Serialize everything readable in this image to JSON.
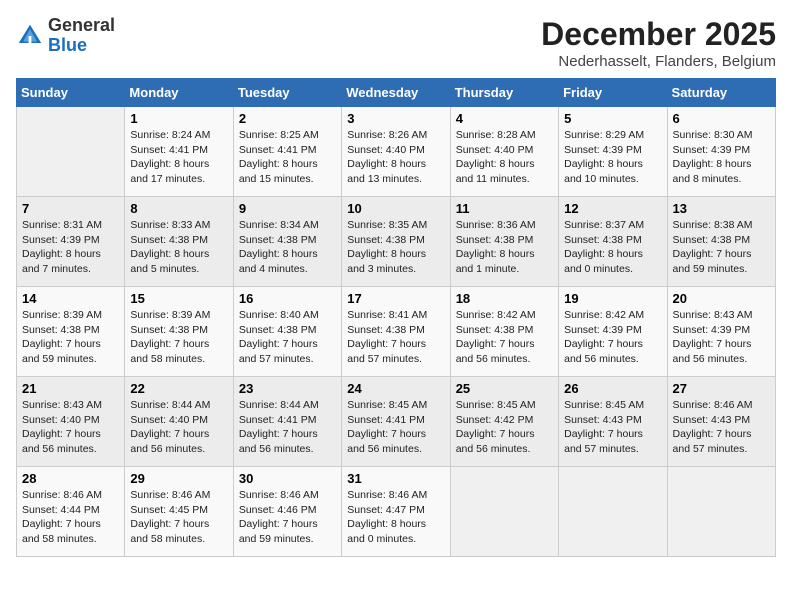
{
  "logo": {
    "general": "General",
    "blue": "Blue"
  },
  "title": "December 2025",
  "subtitle": "Nederhasselt, Flanders, Belgium",
  "days_of_week": [
    "Sunday",
    "Monday",
    "Tuesday",
    "Wednesday",
    "Thursday",
    "Friday",
    "Saturday"
  ],
  "weeks": [
    [
      {
        "day": "",
        "content": ""
      },
      {
        "day": "1",
        "content": "Sunrise: 8:24 AM\nSunset: 4:41 PM\nDaylight: 8 hours\nand 17 minutes."
      },
      {
        "day": "2",
        "content": "Sunrise: 8:25 AM\nSunset: 4:41 PM\nDaylight: 8 hours\nand 15 minutes."
      },
      {
        "day": "3",
        "content": "Sunrise: 8:26 AM\nSunset: 4:40 PM\nDaylight: 8 hours\nand 13 minutes."
      },
      {
        "day": "4",
        "content": "Sunrise: 8:28 AM\nSunset: 4:40 PM\nDaylight: 8 hours\nand 11 minutes."
      },
      {
        "day": "5",
        "content": "Sunrise: 8:29 AM\nSunset: 4:39 PM\nDaylight: 8 hours\nand 10 minutes."
      },
      {
        "day": "6",
        "content": "Sunrise: 8:30 AM\nSunset: 4:39 PM\nDaylight: 8 hours\nand 8 minutes."
      }
    ],
    [
      {
        "day": "7",
        "content": "Sunrise: 8:31 AM\nSunset: 4:39 PM\nDaylight: 8 hours\nand 7 minutes."
      },
      {
        "day": "8",
        "content": "Sunrise: 8:33 AM\nSunset: 4:38 PM\nDaylight: 8 hours\nand 5 minutes."
      },
      {
        "day": "9",
        "content": "Sunrise: 8:34 AM\nSunset: 4:38 PM\nDaylight: 8 hours\nand 4 minutes."
      },
      {
        "day": "10",
        "content": "Sunrise: 8:35 AM\nSunset: 4:38 PM\nDaylight: 8 hours\nand 3 minutes."
      },
      {
        "day": "11",
        "content": "Sunrise: 8:36 AM\nSunset: 4:38 PM\nDaylight: 8 hours\nand 1 minute."
      },
      {
        "day": "12",
        "content": "Sunrise: 8:37 AM\nSunset: 4:38 PM\nDaylight: 8 hours\nand 0 minutes."
      },
      {
        "day": "13",
        "content": "Sunrise: 8:38 AM\nSunset: 4:38 PM\nDaylight: 7 hours\nand 59 minutes."
      }
    ],
    [
      {
        "day": "14",
        "content": "Sunrise: 8:39 AM\nSunset: 4:38 PM\nDaylight: 7 hours\nand 59 minutes."
      },
      {
        "day": "15",
        "content": "Sunrise: 8:39 AM\nSunset: 4:38 PM\nDaylight: 7 hours\nand 58 minutes."
      },
      {
        "day": "16",
        "content": "Sunrise: 8:40 AM\nSunset: 4:38 PM\nDaylight: 7 hours\nand 57 minutes."
      },
      {
        "day": "17",
        "content": "Sunrise: 8:41 AM\nSunset: 4:38 PM\nDaylight: 7 hours\nand 57 minutes."
      },
      {
        "day": "18",
        "content": "Sunrise: 8:42 AM\nSunset: 4:38 PM\nDaylight: 7 hours\nand 56 minutes."
      },
      {
        "day": "19",
        "content": "Sunrise: 8:42 AM\nSunset: 4:39 PM\nDaylight: 7 hours\nand 56 minutes."
      },
      {
        "day": "20",
        "content": "Sunrise: 8:43 AM\nSunset: 4:39 PM\nDaylight: 7 hours\nand 56 minutes."
      }
    ],
    [
      {
        "day": "21",
        "content": "Sunrise: 8:43 AM\nSunset: 4:40 PM\nDaylight: 7 hours\nand 56 minutes."
      },
      {
        "day": "22",
        "content": "Sunrise: 8:44 AM\nSunset: 4:40 PM\nDaylight: 7 hours\nand 56 minutes."
      },
      {
        "day": "23",
        "content": "Sunrise: 8:44 AM\nSunset: 4:41 PM\nDaylight: 7 hours\nand 56 minutes."
      },
      {
        "day": "24",
        "content": "Sunrise: 8:45 AM\nSunset: 4:41 PM\nDaylight: 7 hours\nand 56 minutes."
      },
      {
        "day": "25",
        "content": "Sunrise: 8:45 AM\nSunset: 4:42 PM\nDaylight: 7 hours\nand 56 minutes."
      },
      {
        "day": "26",
        "content": "Sunrise: 8:45 AM\nSunset: 4:43 PM\nDaylight: 7 hours\nand 57 minutes."
      },
      {
        "day": "27",
        "content": "Sunrise: 8:46 AM\nSunset: 4:43 PM\nDaylight: 7 hours\nand 57 minutes."
      }
    ],
    [
      {
        "day": "28",
        "content": "Sunrise: 8:46 AM\nSunset: 4:44 PM\nDaylight: 7 hours\nand 58 minutes."
      },
      {
        "day": "29",
        "content": "Sunrise: 8:46 AM\nSunset: 4:45 PM\nDaylight: 7 hours\nand 58 minutes."
      },
      {
        "day": "30",
        "content": "Sunrise: 8:46 AM\nSunset: 4:46 PM\nDaylight: 7 hours\nand 59 minutes."
      },
      {
        "day": "31",
        "content": "Sunrise: 8:46 AM\nSunset: 4:47 PM\nDaylight: 8 hours\nand 0 minutes."
      },
      {
        "day": "",
        "content": ""
      },
      {
        "day": "",
        "content": ""
      },
      {
        "day": "",
        "content": ""
      }
    ]
  ]
}
